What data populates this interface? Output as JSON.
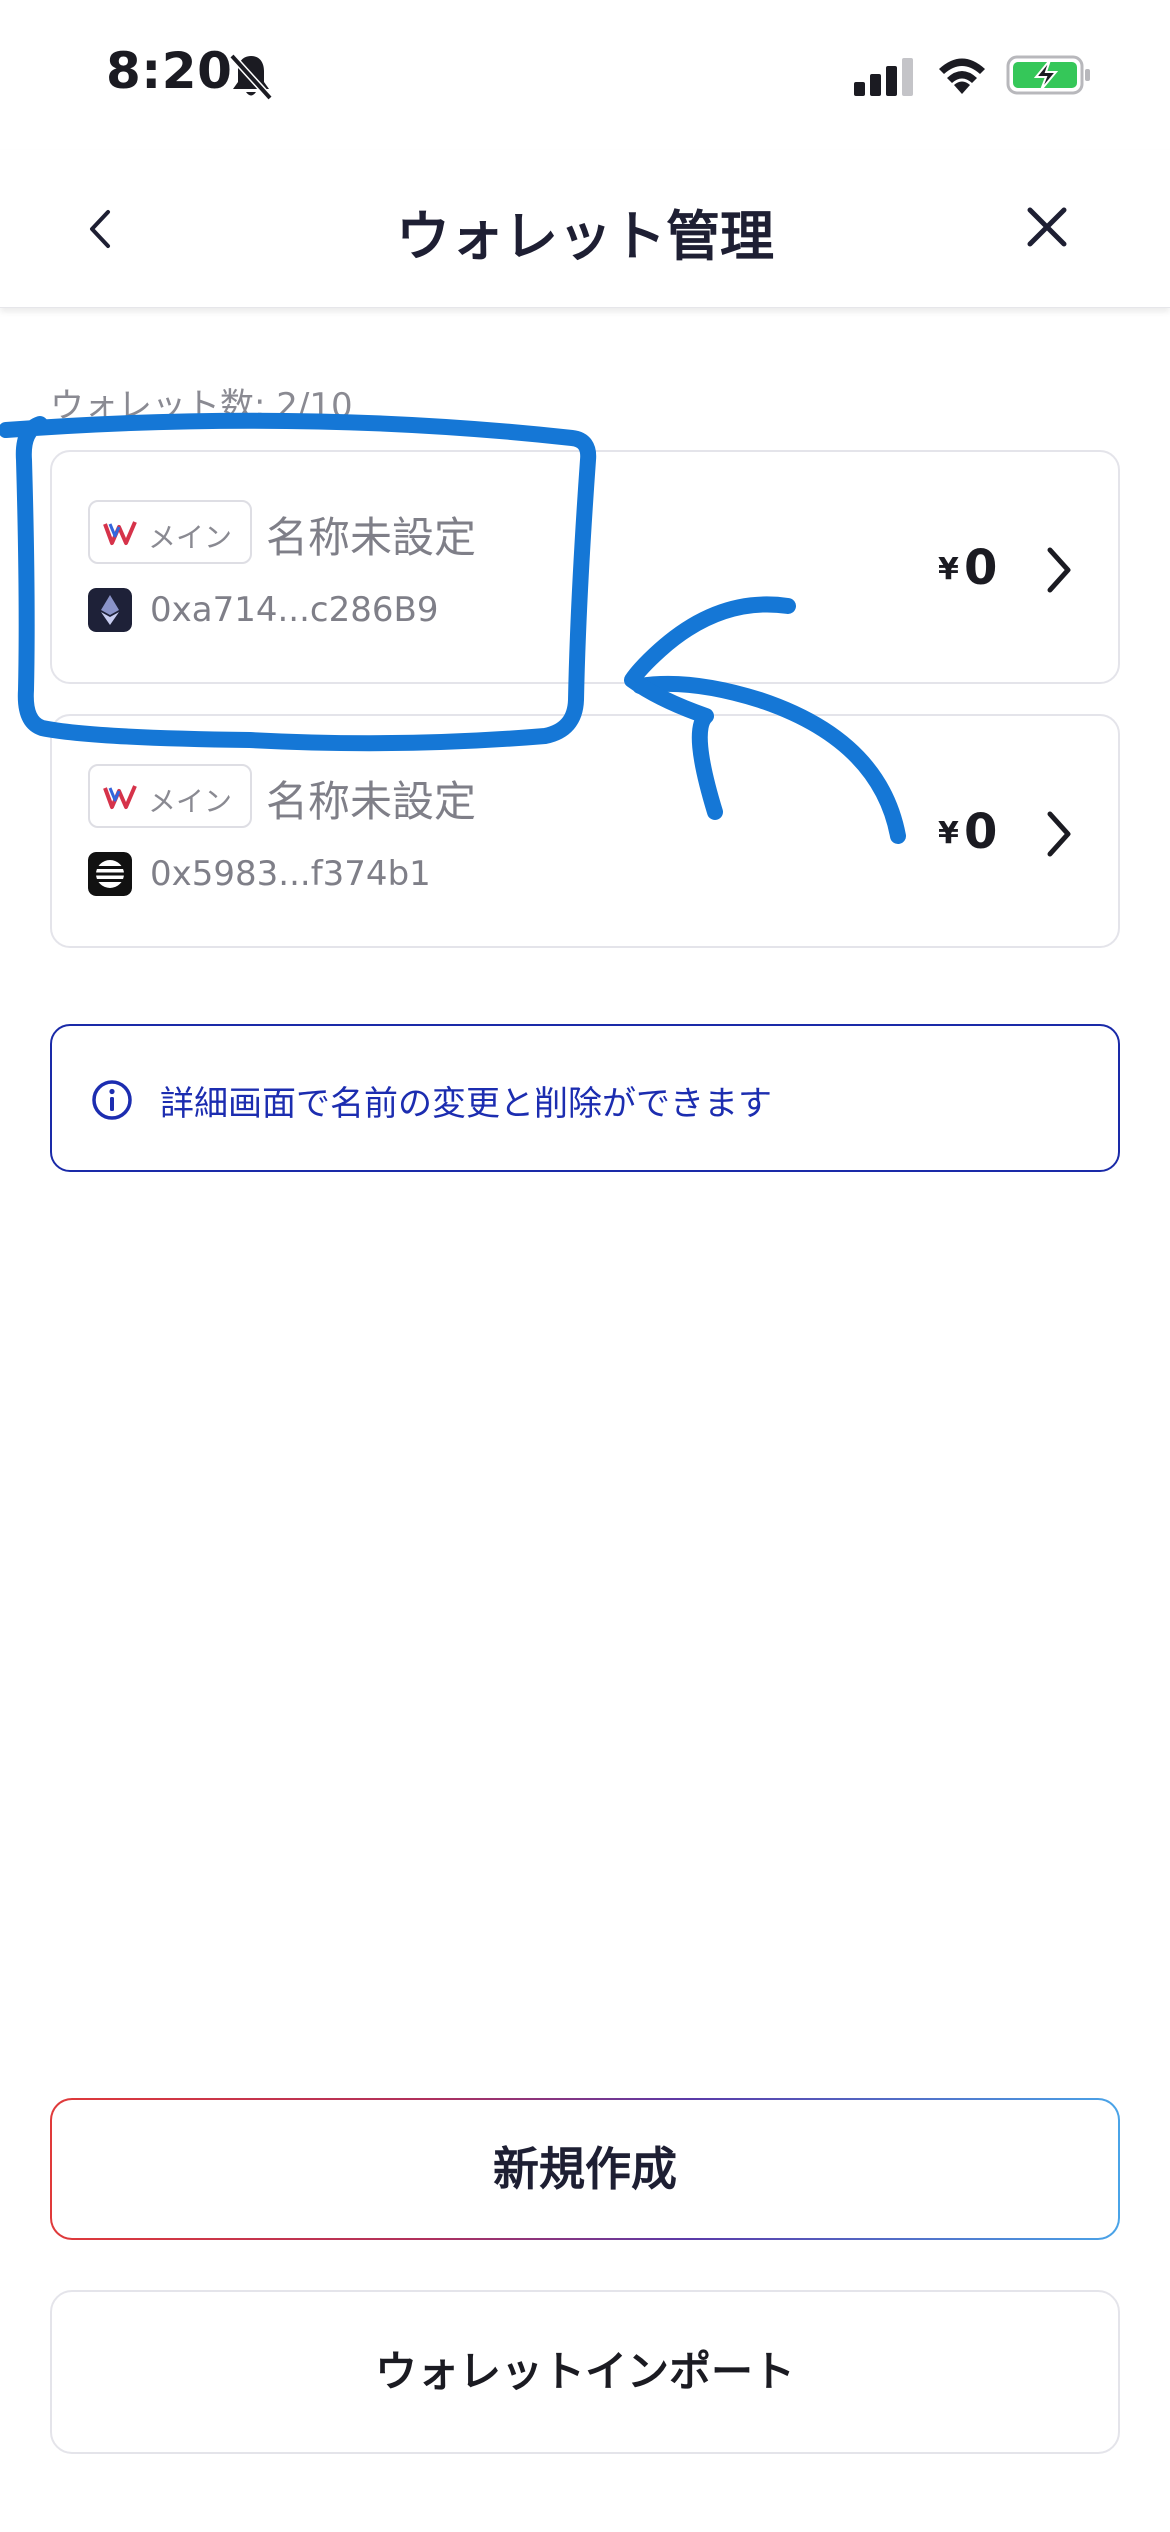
{
  "status_bar": {
    "time": "8:20",
    "icons": [
      "bell-slash-icon",
      "cellular-signal-icon",
      "wifi-icon",
      "battery-charging-icon"
    ]
  },
  "nav": {
    "title": "ウォレット管理",
    "back_icon": "chevron-left-icon",
    "close_icon": "close-icon"
  },
  "wallet_count": "ウォレット数: 2/10",
  "wallets": [
    {
      "badge": "メイン",
      "name": "名称未設定",
      "address": "0xa714...c286B9",
      "chain_icon": "ethereum-icon",
      "currency": "¥",
      "balance": "0"
    },
    {
      "badge": "メイン",
      "name": "名称未設定",
      "address": "0x5983...f374b1",
      "chain_icon": "chain-logo-icon",
      "currency": "¥",
      "balance": "0"
    }
  ],
  "info": {
    "text": "詳細画面で名前の変更と削除ができます"
  },
  "buttons": {
    "create": "新規作成",
    "import": "ウォレットインポート"
  },
  "colors": {
    "accent_blue": "#1a2aa8",
    "annotation_blue": "#1577d6",
    "battery_green": "#35c759"
  }
}
